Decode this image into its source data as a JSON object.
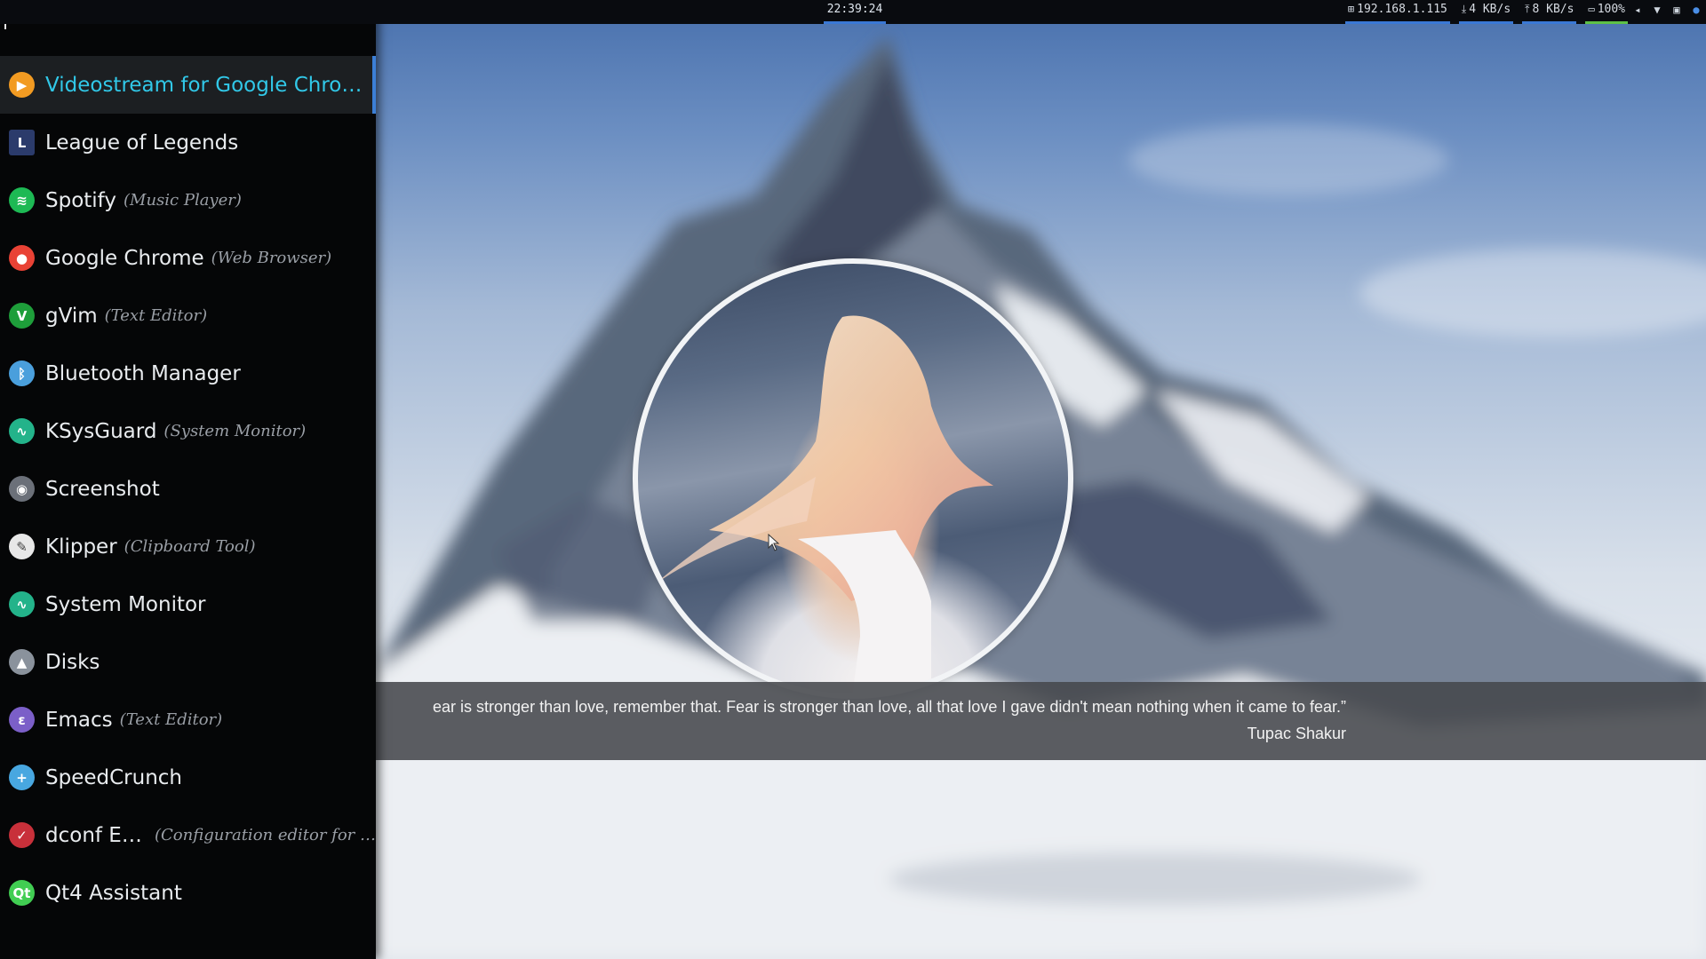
{
  "topbar": {
    "clock": "22:39:24",
    "ip": "192.168.1.115",
    "download": "4 KB/s",
    "upload": "8 KB/s",
    "battery": "100%"
  },
  "launcher": {
    "entries": [
      {
        "name": "Videostream for Google Chrom…",
        "desc": "",
        "icon": "videostream-icon",
        "color": "#f29b22",
        "glyph": "▶"
      },
      {
        "name": "League of Legends",
        "desc": "",
        "icon": "league-of-legends-icon",
        "color": "#2b3b6b",
        "glyph": "L"
      },
      {
        "name": "Spotify",
        "desc": "(Music Player)",
        "icon": "spotify-icon",
        "color": "#1db954",
        "glyph": "≋"
      },
      {
        "name": "Google Chrome",
        "desc": "(Web Browser)",
        "icon": "chrome-icon",
        "color": "#e94235",
        "glyph": "●"
      },
      {
        "name": "gVim",
        "desc": "(Text Editor)",
        "icon": "vim-icon",
        "color": "#1e9e3a",
        "glyph": "V"
      },
      {
        "name": "Bluetooth Manager",
        "desc": "",
        "icon": "bluetooth-icon",
        "color": "#4a9fdc",
        "glyph": "ᛒ"
      },
      {
        "name": "KSysGuard",
        "desc": "(System Monitor)",
        "icon": "ksysguard-icon",
        "color": "#23b38a",
        "glyph": "∿"
      },
      {
        "name": "Screenshot",
        "desc": "",
        "icon": "screenshot-icon",
        "color": "#6b7079",
        "glyph": "◉"
      },
      {
        "name": "Klipper",
        "desc": "(Clipboard Tool)",
        "icon": "klipper-icon",
        "color": "#e8e8e8",
        "glyph": "✎"
      },
      {
        "name": "System Monitor",
        "desc": "",
        "icon": "system-monitor-icon",
        "color": "#23b38a",
        "glyph": "∿"
      },
      {
        "name": "Disks",
        "desc": "",
        "icon": "disks-icon",
        "color": "#8a929c",
        "glyph": "▲"
      },
      {
        "name": "Emacs",
        "desc": "(Text Editor)",
        "icon": "emacs-icon",
        "color": "#7b5fc8",
        "glyph": "ε"
      },
      {
        "name": "SpeedCrunch",
        "desc": "",
        "icon": "speedcrunch-icon",
        "color": "#48a7e0",
        "glyph": "+"
      },
      {
        "name": "dconf Editor",
        "desc": "(Configuration editor for …",
        "icon": "dconf-editor-icon",
        "color": "#c8303a",
        "glyph": "✓"
      },
      {
        "name": "Qt4 Assistant",
        "desc": "",
        "icon": "qt-icon",
        "color": "#41cd52",
        "glyph": "Qt"
      }
    ]
  },
  "lockscreen": {
    "quote": "ear is stronger than love, remember that. Fear is stronger than love, all that love I gave didn't mean nothing when it came to fear.”",
    "author": "Tupac Shakur"
  },
  "colors": {
    "accent": "#31c8e8",
    "selection_bar": "#3c7fd6",
    "battery_ok": "#5ec046"
  }
}
